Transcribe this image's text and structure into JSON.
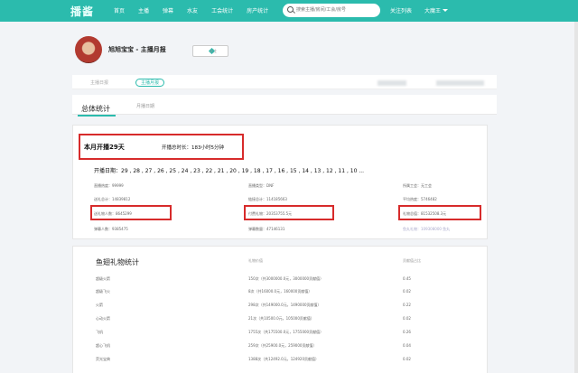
{
  "header": {
    "logo": "播酱",
    "nav": [
      "首页",
      "主播",
      "弹幕",
      "水友",
      "工会统计",
      "房产统计"
    ],
    "search_placeholder": "搜索主播/房间/工会/房号",
    "follow_list": "关注列表",
    "user": "大魔王"
  },
  "colors": {
    "accent": "#2bbbad",
    "highlight": "#d72b2b"
  },
  "profile": {
    "name": "旭旭宝宝 - 主播月报",
    "follow_label": "关注"
  },
  "tabs": {
    "daily": "主播日报",
    "monthly": "主播月报"
  },
  "subtabs": {
    "overall": "总体统计",
    "monthly_daily": "月播日期"
  },
  "summary": {
    "month_days": "本月开播29天",
    "total_duration": "开播总时长：183小时5分钟",
    "days_line": "开播日期：29 , 28 , 27 , 26 , 25 , 24 , 23 , 22 , 21 , 20 , 19 , 18 , 17 , 16 , 15 , 14 , 13 , 12 , 11 , 10 ..."
  },
  "stats": {
    "col1": [
      "直播热度：99999",
      "送礼总计：14839812",
      "送礼物人数：8645299",
      "弹幕人数：9385475"
    ],
    "col2": [
      "直播类型：DNF",
      "链接总计：114185663",
      "付费礼物：20353755.5元",
      "弹幕数量：47146131"
    ],
    "col3": [
      "所属工会：无工会",
      "平均热度：5746482",
      "礼物总值：81532508.3元",
      "鱼丸礼物：109308000 鱼丸"
    ]
  },
  "gifts": {
    "title": "鱼翅礼物统计",
    "headers": [
      "礼物价值",
      "贡献值占比"
    ],
    "names": [
      "超级火箭",
      "超级飞火",
      "火箭",
      "心动火箭",
      "飞机",
      "超心飞机",
      "荧光宝典"
    ],
    "values": [
      "150次（共3000000.0元，3000000贡献值）",
      "8次（共16000.0元，160000贡献值）",
      "298次（共149000.0元，1490000贡献值）",
      "21次（共10500.0元，105000贡献值）",
      "1755次（共175500.0元，1755000贡献值）",
      "259次（共25900.0元，259000贡献值）",
      "1388次（共12492.0元，124920贡献值）"
    ],
    "ratios": [
      "0.45",
      "0.02",
      "0.22",
      "0.02",
      "0.26",
      "0.04",
      "0.02"
    ]
  }
}
